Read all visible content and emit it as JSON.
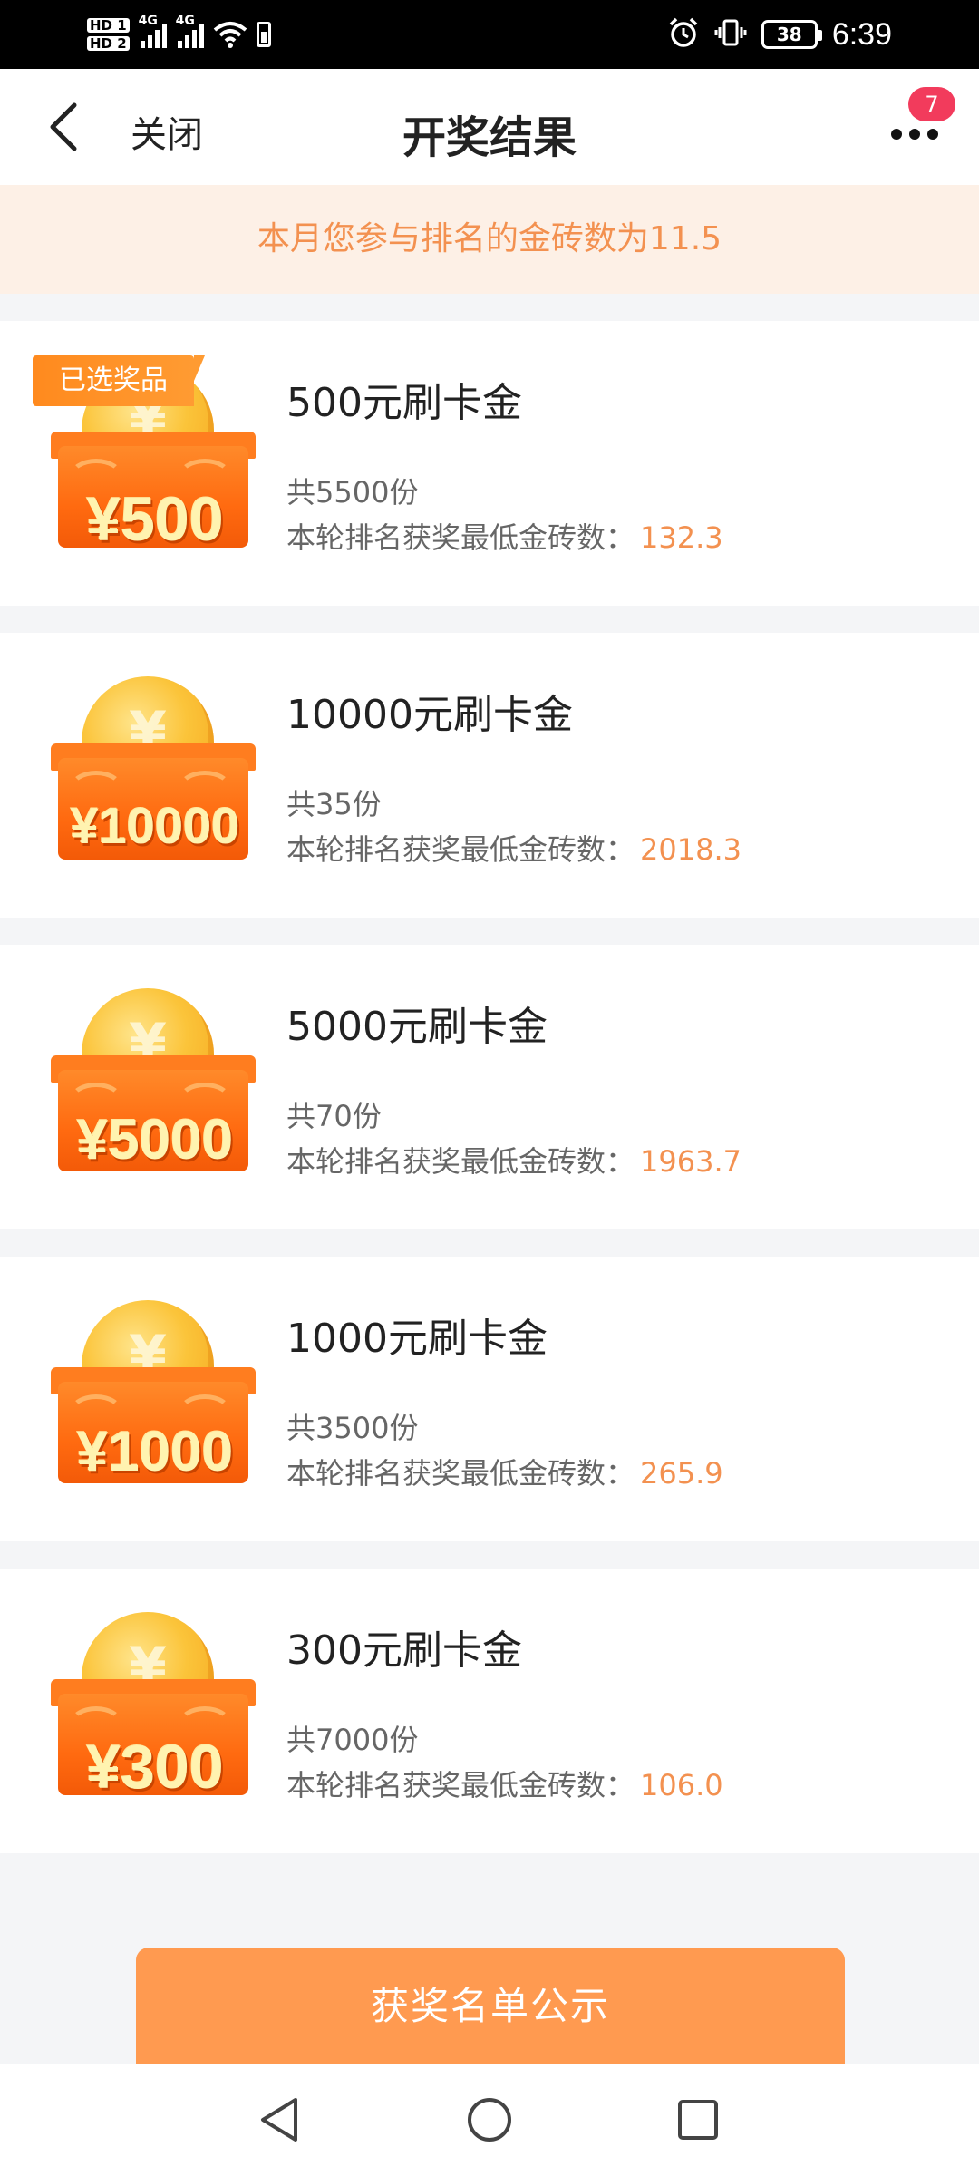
{
  "status_bar": {
    "hd1": "HD 1",
    "hd2": "HD 2",
    "net1": "4G",
    "net2": "4G",
    "battery": "38",
    "time": "6:39"
  },
  "header": {
    "close_label": "关闭",
    "title": "开奖结果",
    "more_badge": "7"
  },
  "notice": "本月您参与排名的金砖数为11.5",
  "prizes": [
    {
      "name": "500元刷卡金",
      "amount": "¥500",
      "count": "共5500份",
      "min_label": "本轮排名获奖最低金砖数：",
      "min_value": "132.3",
      "selected_tag": "已选奖品"
    },
    {
      "name": "10000元刷卡金",
      "amount": "¥10000",
      "count": "共35份",
      "min_label": "本轮排名获奖最低金砖数：",
      "min_value": "2018.3"
    },
    {
      "name": "5000元刷卡金",
      "amount": "¥5000",
      "count": "共70份",
      "min_label": "本轮排名获奖最低金砖数：",
      "min_value": "1963.7"
    },
    {
      "name": "1000元刷卡金",
      "amount": "¥1000",
      "count": "共3500份",
      "min_label": "本轮排名获奖最低金砖数：",
      "min_value": "265.9"
    },
    {
      "name": "300元刷卡金",
      "amount": "¥300",
      "count": "共7000份",
      "min_label": "本轮排名获奖最低金砖数：",
      "min_value": "106.0"
    }
  ],
  "publish_button": "获奖名单公示",
  "nav": [
    "back-icon",
    "home-icon",
    "recents-icon"
  ],
  "colors": {
    "accent": "#f39150",
    "button": "#ff9a50",
    "notice_bg": "#fdf0e6",
    "badge": "#f23b5c"
  }
}
